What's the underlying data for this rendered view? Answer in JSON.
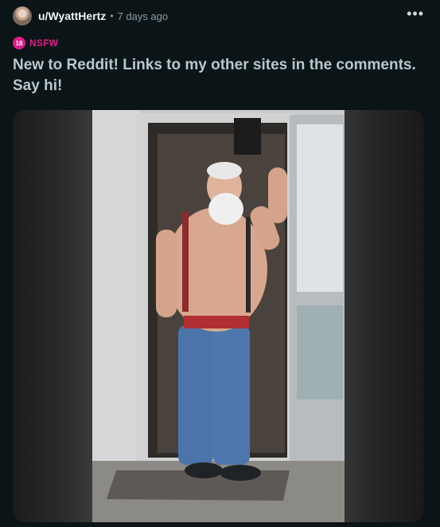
{
  "post": {
    "author": "u/WyattHertz",
    "separator": "•",
    "time_ago": "7 days ago",
    "more_label": "•••",
    "nsfw_badge": "18",
    "nsfw_label": "NSFW",
    "title": "New to Reddit! Links to my other sites in the comments. Say hi!"
  },
  "colors": {
    "background": "#0b1416",
    "nsfw_accent": "#e01a8a",
    "title": "#b7c8cd"
  },
  "icons": [
    "avatar",
    "more-options-icon",
    "nsfw-icon"
  ]
}
